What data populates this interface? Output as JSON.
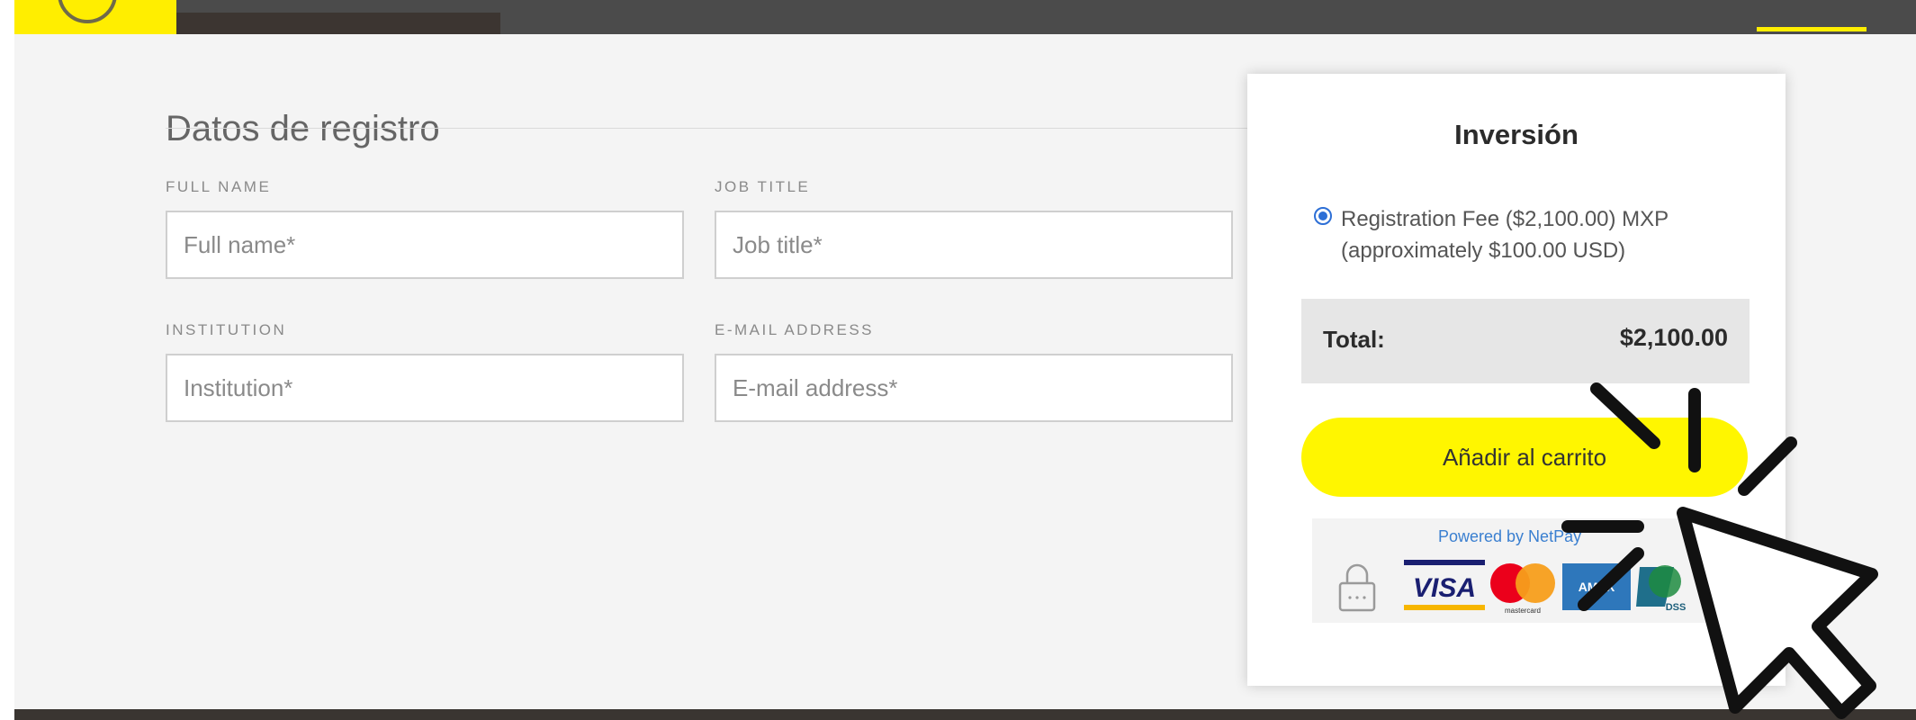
{
  "form": {
    "title": "Datos de registro",
    "fields": [
      {
        "label": "FULL NAME",
        "placeholder": "Full name*"
      },
      {
        "label": "JOB TITLE",
        "placeholder": "Job title*"
      },
      {
        "label": "INSTITUTION",
        "placeholder": "Institution*"
      },
      {
        "label": "E-MAIL ADDRESS",
        "placeholder": "E-mail address*"
      }
    ]
  },
  "summary": {
    "title": "Inversión",
    "option": {
      "selected": true,
      "line1": "Registration Fee ($2,100.00) MXP",
      "line2": "(approximately $100.00 USD)"
    },
    "total_label": "Total:",
    "total_value": "$2,100.00",
    "add_button": "Añadir al carrito",
    "payment": {
      "powered_by": "Powered by NetPay",
      "logos": [
        "visa-logo",
        "mastercard-logo",
        "amex-logo",
        "pci-dss-logo"
      ],
      "visa_text": "VISA",
      "mastercard_text": "mastercard",
      "amex_text": "AMEX",
      "dss_text": "DSS"
    }
  },
  "colors": {
    "accent_yellow": "#fff600",
    "page_bg": "#f4f4f4",
    "radio_blue": "#2d6fd6",
    "link_blue": "#3a7fd0"
  },
  "icons": [
    "lock-icon",
    "cursor-click-icon"
  ]
}
